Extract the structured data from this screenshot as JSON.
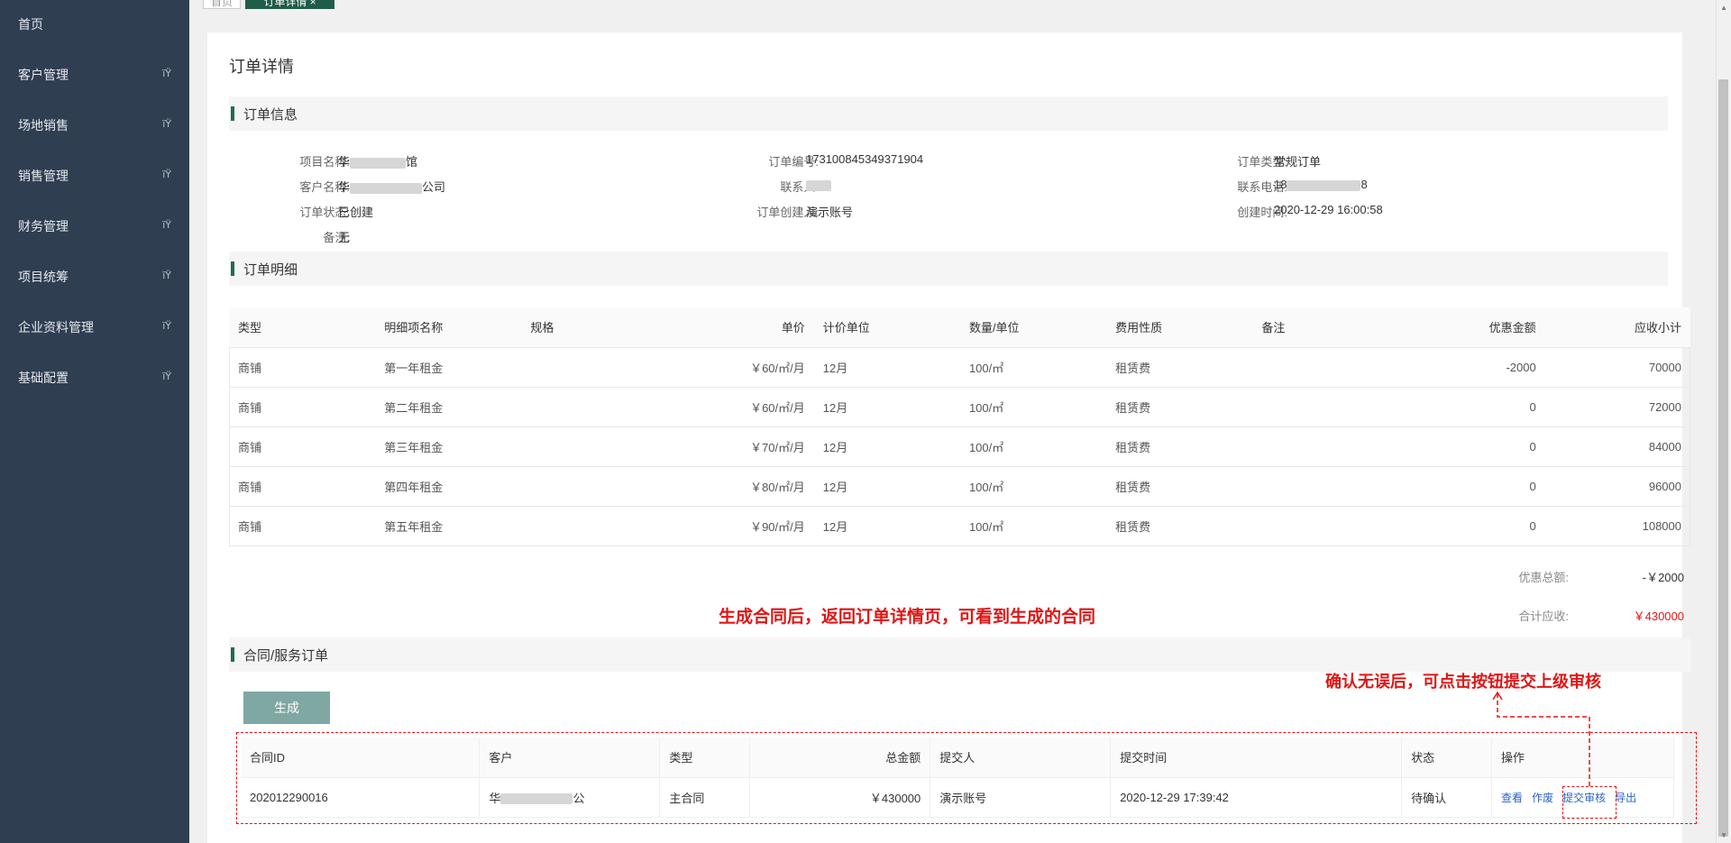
{
  "sidebar": {
    "items": [
      {
        "label": "首页",
        "has_submenu": false
      },
      {
        "label": "客户管理",
        "has_submenu": true
      },
      {
        "label": "场地销售",
        "has_submenu": true
      },
      {
        "label": "销售管理",
        "has_submenu": true
      },
      {
        "label": "财务管理",
        "has_submenu": true
      },
      {
        "label": "项目统筹",
        "has_submenu": true
      },
      {
        "label": "企业资料管理",
        "has_submenu": true
      },
      {
        "label": "基础配置",
        "has_submenu": true
      }
    ],
    "caret_glyph": "ïŸ"
  },
  "tabs": {
    "home": "首页",
    "active": "订单详情 ×"
  },
  "page": {
    "title": "订单详情"
  },
  "order_info": {
    "section_title": "订单信息",
    "fields": {
      "project_name_label": "项目名称:",
      "project_name_value_start": "华",
      "project_name_value_end": "馆",
      "customer_name_label": "客户名称:",
      "customer_name_value_start": "华",
      "customer_name_value_end": "公司",
      "status_label": "订单状态:",
      "status_value": "已创建",
      "remark_label": "备注:",
      "remark_value": "无",
      "order_no_label": "订单编号:",
      "order_no_value": "173100845349371904",
      "contact_label": "联系人:",
      "creator_label": "订单创建人:",
      "creator_value": "演示账号",
      "order_type_label": "订单类型:",
      "order_type_value": "常规订单",
      "phone_label": "联系电话:",
      "phone_value_start": "18",
      "phone_value_end": "8",
      "created_time_label": "创建时间:",
      "created_time_value": "2020-12-29 16:00:58"
    }
  },
  "order_detail": {
    "section_title": "订单明细",
    "columns": [
      "类型",
      "明细项名称",
      "规格",
      "单价",
      "计价单位",
      "数量/单位",
      "费用性质",
      "备注",
      "优惠金额",
      "应收小计"
    ],
    "rows": [
      [
        "商铺",
        "第一年租金",
        "",
        "￥60/㎡/月",
        "12月",
        "100/㎡",
        "租赁费",
        "",
        "-2000",
        "70000"
      ],
      [
        "商铺",
        "第二年租金",
        "",
        "￥60/㎡/月",
        "12月",
        "100/㎡",
        "租赁费",
        "",
        "0",
        "72000"
      ],
      [
        "商铺",
        "第三年租金",
        "",
        "￥70/㎡/月",
        "12月",
        "100/㎡",
        "租赁费",
        "",
        "0",
        "84000"
      ],
      [
        "商铺",
        "第四年租金",
        "",
        "￥80/㎡/月",
        "12月",
        "100/㎡",
        "租赁费",
        "",
        "0",
        "96000"
      ],
      [
        "商铺",
        "第五年租金",
        "",
        "￥90/㎡/月",
        "12月",
        "100/㎡",
        "租赁费",
        "",
        "0",
        "108000"
      ]
    ],
    "discount_total_label": "优惠总额:",
    "discount_total_value": "-￥2000",
    "total_receivable_label": "合计应收:",
    "total_receivable_value": "￥430000"
  },
  "annotations": {
    "middle": "生成合同后，返回订单详情页，可看到生成的合同",
    "right": "确认无误后，可点击按钮提交上级审核"
  },
  "contracts": {
    "section_title": "合同/服务订单",
    "generate_button": "生成",
    "columns": [
      "合同ID",
      "客户",
      "类型",
      "总金额",
      "提交人",
      "提交时间",
      "状态",
      "操作"
    ],
    "rows": [
      {
        "id": "202012290016",
        "customer_start": "华",
        "customer_end": "公",
        "type": "主合同",
        "amount": "￥430000",
        "submitter": "演示账号",
        "submit_time": "2020-12-29 17:39:42",
        "status": "待确认",
        "actions": [
          "查看",
          "作废",
          "提交审核",
          "导出"
        ]
      }
    ]
  },
  "colors": {
    "sidebar_bg": "#2f3e51",
    "accent_green": "#1f6b58",
    "annotation_red": "#e01515",
    "link_blue": "#2b63c8",
    "generate_button_bg": "#7fa8a3"
  }
}
